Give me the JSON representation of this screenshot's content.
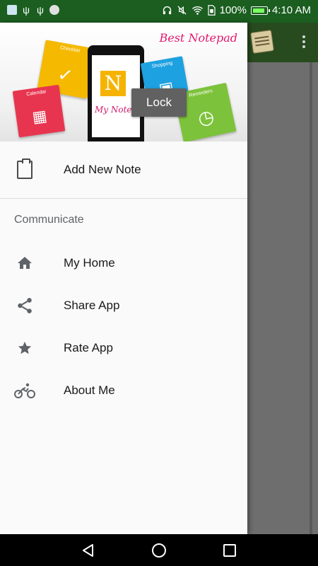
{
  "status_bar": {
    "battery_percent": "100%",
    "time": "4:10 AM",
    "icons": [
      "app-notification-icon",
      "usb-icon",
      "usb-icon",
      "circle-icon",
      "headphones-icon",
      "mute-icon",
      "wifi-icon",
      "sim-icon",
      "battery-icon"
    ]
  },
  "drawer": {
    "header": {
      "best_notepad": "Best Notepad",
      "tile_calendar": "Calendar",
      "tile_checklist": "Checklist",
      "tile_shopping": "Shopping",
      "tile_reminders": "Reminders",
      "phone_app_name": "My Note",
      "phone_logo_letter": "N",
      "tooltip": "Lock"
    },
    "primary_item": {
      "label": "Add New Note",
      "icon": "clipboard-icon"
    },
    "section_title": "Communicate",
    "items": [
      {
        "label": "My Home",
        "icon": "home-icon"
      },
      {
        "label": "Share App",
        "icon": "share-icon"
      },
      {
        "label": "Rate App",
        "icon": "star-icon"
      },
      {
        "label": "About Me",
        "icon": "bicycle-icon"
      }
    ]
  },
  "background_app": {
    "toolbar_icons": [
      "notepad-icon",
      "more-vert-icon"
    ]
  },
  "nav_bar": {
    "buttons": [
      "back-icon",
      "home-circle-icon",
      "recents-icon"
    ]
  },
  "colors": {
    "status_bar": "#1b5e20",
    "drawer_bg": "#fafafa",
    "scrim": "#6e6e6e",
    "tooltip": "#616161",
    "brand_pink": "#e3186f"
  }
}
